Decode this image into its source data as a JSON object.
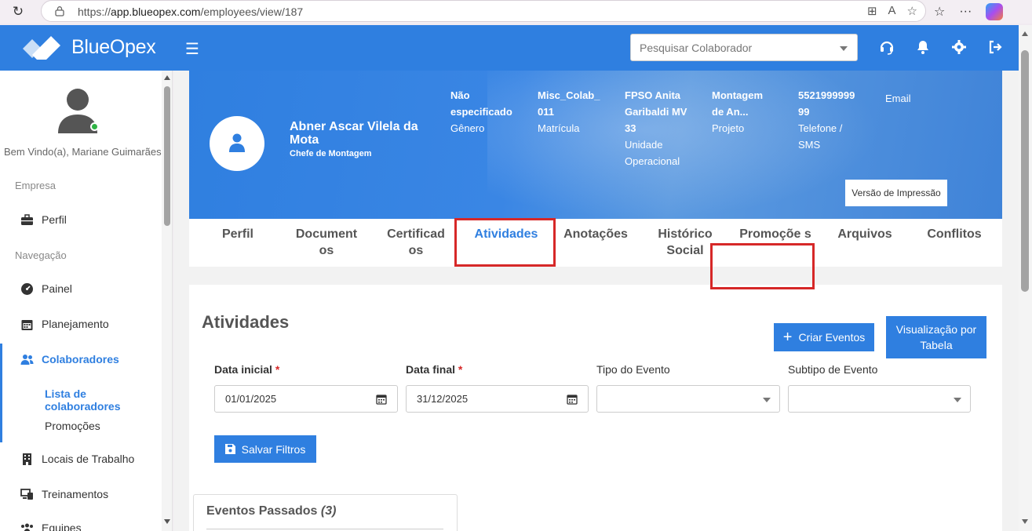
{
  "browser": {
    "url_prefix": "https://",
    "url_host": "app.blueopex.com",
    "url_path": "/employees/view/187"
  },
  "header": {
    "logo_text": "BlueOpex",
    "search_placeholder": "Pesquisar Colaborador",
    "brand_color": "#2f7fe0"
  },
  "sidebar": {
    "welcome": "Bem Vindo(a), Mariane Guimarães",
    "section_empresa": "Empresa",
    "section_navegacao": "Navegação",
    "items": [
      {
        "label": "Perfil",
        "icon": "briefcase-icon"
      },
      {
        "label": "Painel",
        "icon": "dashboard-icon"
      },
      {
        "label": "Planejamento",
        "icon": "calendar-icon"
      },
      {
        "label": "Colaboradores",
        "icon": "users-icon"
      },
      {
        "label": "Locais de Trabalho",
        "icon": "building-icon"
      },
      {
        "label": "Treinamentos",
        "icon": "screen-icon"
      },
      {
        "label": "Equipes",
        "icon": "team-icon"
      }
    ],
    "subitems": [
      {
        "label": "Lista de colaboradores"
      },
      {
        "label": "Promoções"
      }
    ]
  },
  "employee": {
    "name": "Abner Ascar Vilela da Mota",
    "role": "Chefe de Montagem",
    "fields": [
      {
        "value": "Não especificado",
        "label": "Gênero"
      },
      {
        "value": "Misc_Colab_011",
        "label": "Matrícula"
      },
      {
        "value": "FPSO Anita Garibaldi MV 33",
        "label": "Unidade Operacional"
      },
      {
        "value": "Montagem de An...",
        "label": "Projeto"
      },
      {
        "value": "5521999999 99",
        "label": "Telefone / SMS"
      },
      {
        "value": "",
        "label": "Email"
      }
    ],
    "print_button": "Versão de Impressão"
  },
  "tabs": [
    {
      "label": "Perfil"
    },
    {
      "label": "Document os"
    },
    {
      "label": "Certificad os"
    },
    {
      "label": "Atividades"
    },
    {
      "label": "Anotações"
    },
    {
      "label": "Histórico Social"
    },
    {
      "label": "Promoçõe s"
    },
    {
      "label": "Arquivos"
    },
    {
      "label": "Conflitos"
    }
  ],
  "activities": {
    "title": "Atividades",
    "create_button": "Criar Eventos",
    "table_view_button_line1": "Visualização por",
    "table_view_button_line2": "Tabela",
    "date_start_label": "Data inicial",
    "date_start_value": "01/01/2025",
    "date_end_label": "Data final",
    "date_end_value": "31/12/2025",
    "required_mark": "*",
    "event_type_label": "Tipo do Evento",
    "event_subtype_label": "Subtipo de Evento",
    "save_filters_button": "Salvar Filtros",
    "past_events_title": "Eventos Passados",
    "past_events_count": "(3)"
  }
}
